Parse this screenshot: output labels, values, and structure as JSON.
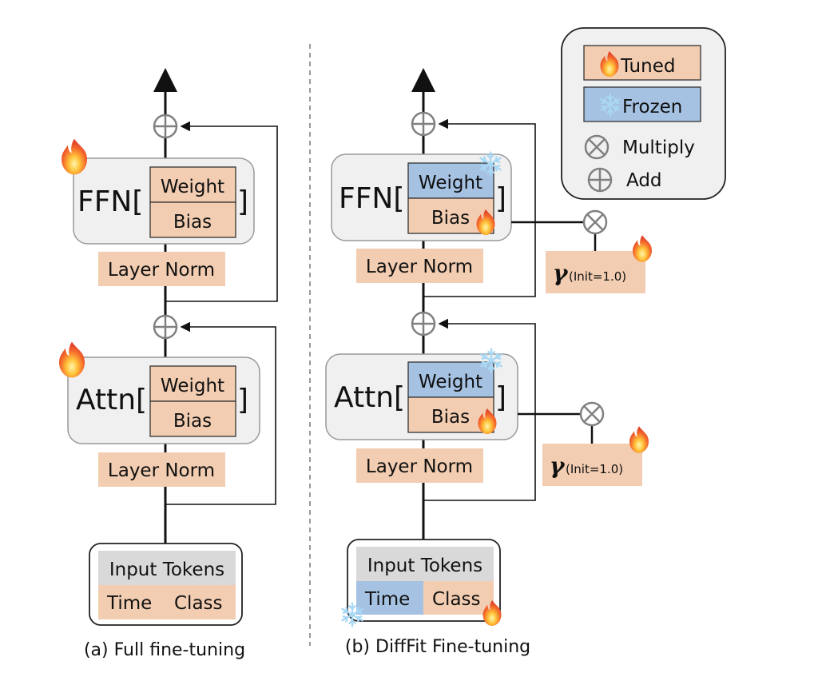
{
  "legend": {
    "tuned": "Tuned",
    "frozen": "Frozen",
    "multiply": "Multiply",
    "add": "Add"
  },
  "colors": {
    "tuned": "#f2cdb1",
    "frozen": "#a6c2e3",
    "block_bg": "#f0f0f0",
    "input_header": "#d9d9d9",
    "circle_op": "#808080"
  },
  "panel_a": {
    "caption": "(a) Full fine-tuning",
    "ffn": {
      "name": "FFN[",
      "close": "]",
      "weight": "Weight",
      "bias": "Bias",
      "weight_state": "tuned",
      "bias_state": "tuned"
    },
    "ffn_norm": "Layer Norm",
    "attn": {
      "name": "Attn[",
      "close": "]",
      "weight": "Weight",
      "bias": "Bias",
      "weight_state": "tuned",
      "bias_state": "tuned"
    },
    "attn_norm": "Layer Norm",
    "input": {
      "header": "Input Tokens",
      "time": "Time",
      "class": "Class",
      "time_state": "tuned",
      "class_state": "tuned"
    }
  },
  "panel_b": {
    "caption": "(b) DiffFit Fine-tuning",
    "ffn": {
      "name": "FFN[",
      "close": "]",
      "weight": "Weight",
      "bias": "Bias",
      "weight_state": "frozen",
      "bias_state": "tuned"
    },
    "ffn_norm": "Layer Norm",
    "ffn_gamma": {
      "symbol": "γ",
      "init": "(Init=1.0)"
    },
    "attn": {
      "name": "Attn[",
      "close": "]",
      "weight": "Weight",
      "bias": "Bias",
      "weight_state": "frozen",
      "bias_state": "tuned"
    },
    "attn_norm": "Layer Norm",
    "attn_gamma": {
      "symbol": "γ",
      "init": "(Init=1.0)"
    },
    "input": {
      "header": "Input Tokens",
      "time": "Time",
      "class": "Class",
      "time_state": "frozen",
      "class_state": "tuned"
    }
  }
}
